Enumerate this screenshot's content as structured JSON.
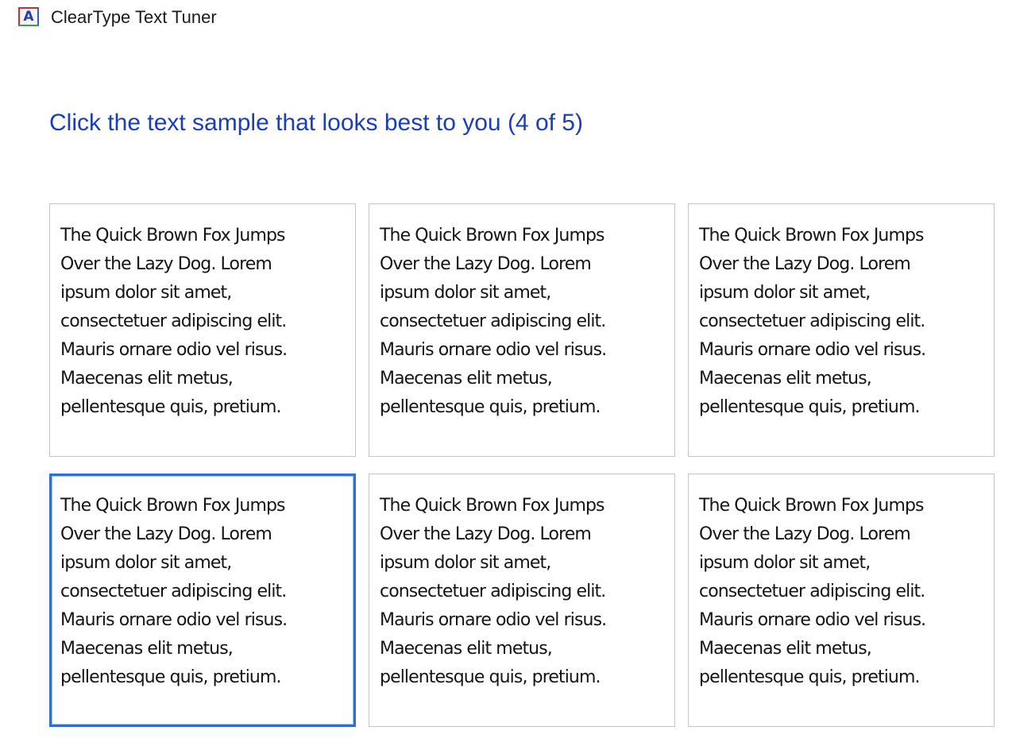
{
  "window": {
    "icon": "cleartype-a-icon",
    "icon_glyph": "A",
    "title": "ClearType Text Tuner"
  },
  "instruction": "Click the text sample that looks best to you (4 of 5)",
  "samples": [
    {
      "text": "The Quick Brown Fox Jumps\nOver the Lazy Dog. Lorem\nipsum dolor sit amet,\nconsectetuer adipiscing elit.\nMauris ornare odio vel risus.\nMaecenas elit metus,\npellentesque quis, pretium.",
      "selected": false
    },
    {
      "text": "The Quick Brown Fox Jumps\nOver the Lazy Dog. Lorem\nipsum dolor sit amet,\nconsectetuer adipiscing elit.\nMauris ornare odio vel risus.\nMaecenas elit metus,\npellentesque quis, pretium.",
      "selected": false
    },
    {
      "text": "The Quick Brown Fox Jumps\nOver the Lazy Dog. Lorem\nipsum dolor sit amet,\nconsectetuer adipiscing elit.\nMauris ornare odio vel risus.\nMaecenas elit metus,\npellentesque quis, pretium.",
      "selected": false
    },
    {
      "text": "The Quick Brown Fox Jumps\nOver the Lazy Dog. Lorem\nipsum dolor sit amet,\nconsectetuer adipiscing elit.\nMauris ornare odio vel risus.\nMaecenas elit metus,\npellentesque quis, pretium.",
      "selected": true
    },
    {
      "text": "The Quick Brown Fox Jumps\nOver the Lazy Dog. Lorem\nipsum dolor sit amet,\nconsectetuer adipiscing elit.\nMauris ornare odio vel risus.\nMaecenas elit metus,\npellentesque quis, pretium.",
      "selected": false
    },
    {
      "text": "The Quick Brown Fox Jumps\nOver the Lazy Dog. Lorem\nipsum dolor sit amet,\nconsectetuer adipiscing elit.\nMauris ornare odio vel risus.\nMaecenas elit metus,\npellentesque quis, pretium.",
      "selected": false
    }
  ],
  "colors": {
    "instruction_text": "#1a3fb5",
    "selection_border": "#2f6fd0",
    "sample_border": "#c4c4c4"
  }
}
